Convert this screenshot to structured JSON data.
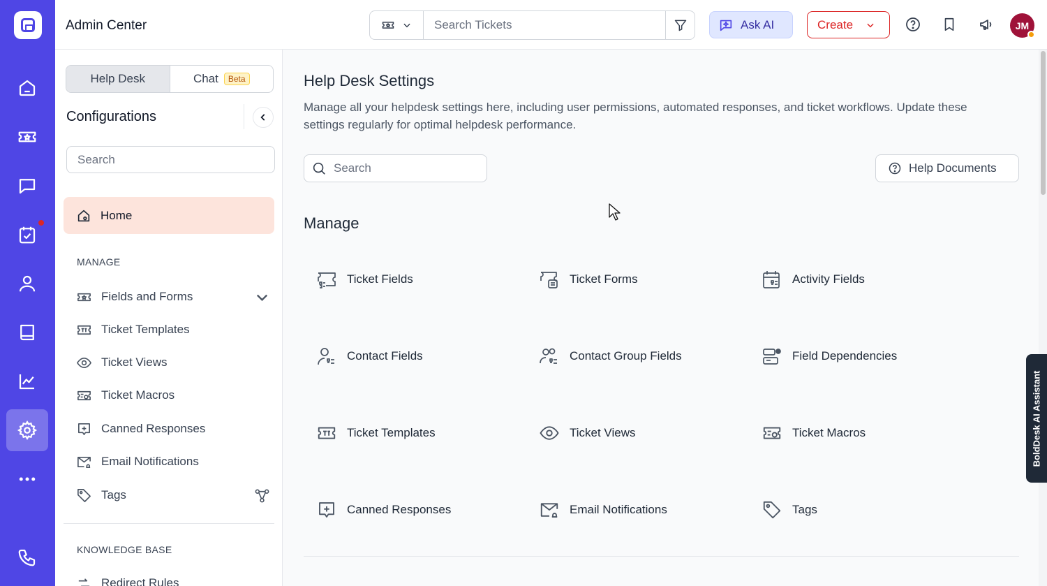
{
  "rail": {
    "items": [
      {
        "name": "home-icon"
      },
      {
        "name": "tickets-icon"
      },
      {
        "name": "chat-icon"
      },
      {
        "name": "tasks-icon",
        "has_notification": true
      },
      {
        "name": "contacts-icon"
      },
      {
        "name": "knowledge-base-icon"
      },
      {
        "name": "reports-icon"
      },
      {
        "name": "settings-icon",
        "active": true
      },
      {
        "name": "more-icon"
      },
      {
        "name": "phone-icon"
      }
    ],
    "accent": "#4f46e5"
  },
  "header": {
    "title": "Admin Center",
    "search_placeholder": "Search Tickets",
    "ask_ai_label": "Ask AI",
    "create_label": "Create",
    "avatar_initials": "JM"
  },
  "sidebar": {
    "tabs": [
      {
        "label": "Help Desk",
        "active": true
      },
      {
        "label": "Chat",
        "badge": "Beta"
      }
    ],
    "title": "Configurations",
    "search_placeholder": "Search",
    "home_label": "Home",
    "manage_label": "MANAGE",
    "items": [
      {
        "label": "Fields and Forms",
        "icon": "fields-forms-icon",
        "trailing": "chevron-down-icon"
      },
      {
        "label": "Ticket Templates",
        "icon": "ticket-template-icon"
      },
      {
        "label": "Ticket Views",
        "icon": "eye-icon"
      },
      {
        "label": "Ticket Macros",
        "icon": "ticket-macro-icon"
      },
      {
        "label": "Canned Responses",
        "icon": "canned-response-icon"
      },
      {
        "label": "Email Notifications",
        "icon": "email-notification-icon"
      },
      {
        "label": "Tags",
        "icon": "tag-icon",
        "trailing": "hierarchy-icon"
      }
    ],
    "kb_label": "KNOWLEDGE BASE",
    "kb_items": [
      {
        "label": "Redirect Rules",
        "icon": "redirect-icon"
      }
    ]
  },
  "main": {
    "title": "Help Desk Settings",
    "description": "Manage all your helpdesk settings here, including user permissions, automated responses, and ticket workflows. Update these settings regularly for optimal helpdesk performance.",
    "search_placeholder": "Search",
    "help_docs_label": "Help Documents",
    "manage_title": "Manage",
    "cards": [
      {
        "label": "Ticket Fields",
        "icon": "ticket-fields-icon"
      },
      {
        "label": "Ticket Forms",
        "icon": "ticket-forms-icon"
      },
      {
        "label": "Activity Fields",
        "icon": "activity-fields-icon"
      },
      {
        "label": "Contact Fields",
        "icon": "contact-fields-icon"
      },
      {
        "label": "Contact Group Fields",
        "icon": "contact-group-fields-icon"
      },
      {
        "label": "Field Dependencies",
        "icon": "field-dependencies-icon"
      },
      {
        "label": "Ticket Templates",
        "icon": "ticket-template-icon"
      },
      {
        "label": "Ticket Views",
        "icon": "eye-icon"
      },
      {
        "label": "Ticket Macros",
        "icon": "ticket-macro-icon"
      },
      {
        "label": "Canned Responses",
        "icon": "canned-response-icon"
      },
      {
        "label": "Email Notifications",
        "icon": "email-notification-icon"
      },
      {
        "label": "Tags",
        "icon": "tag-icon"
      }
    ]
  },
  "ai_assistant_label": "BoldDesk AI Assistant"
}
